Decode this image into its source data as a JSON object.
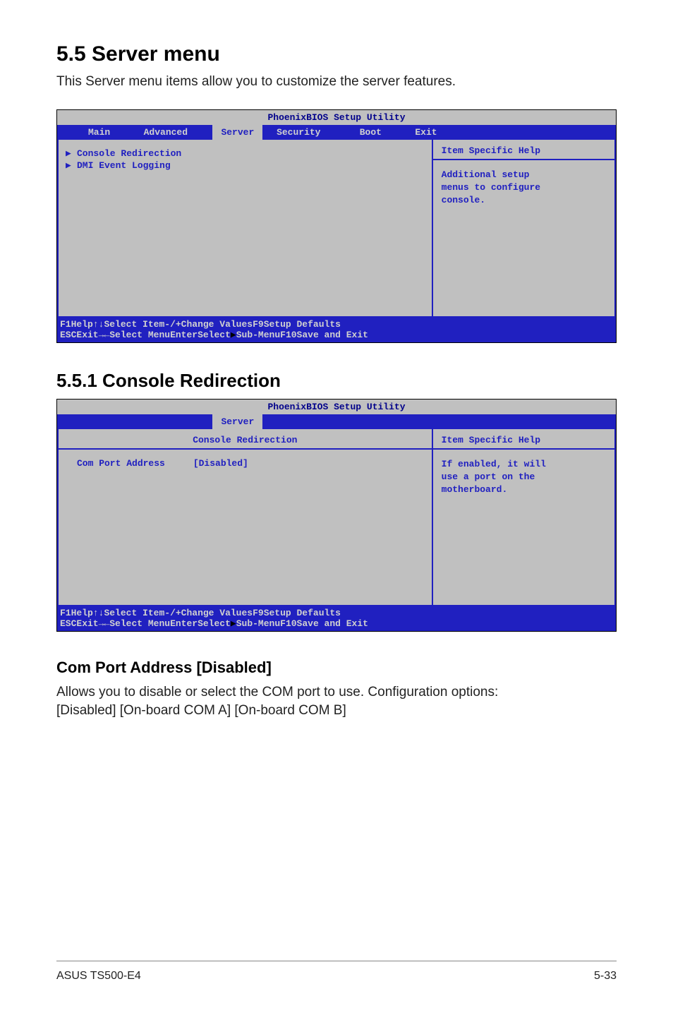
{
  "section_heading": "5.5 Server menu",
  "section_intro": "This Server menu items allow you to customize the server features.",
  "bios1": {
    "title": "PhoenixBIOS Setup Utility",
    "tabs": {
      "main": "Main",
      "advanced": "Advanced",
      "server": "Server",
      "security": "Security",
      "boot": "Boot",
      "exit": "Exit"
    },
    "rows": {
      "r1": "Console Redirection",
      "r2": "DMI Event Logging"
    },
    "help_header": "Item Specific Help",
    "help_text": "Additional setup\nmenus to configure\nconsole."
  },
  "sub_heading": "5.5.1 Console Redirection",
  "bios2": {
    "title": "PhoenixBIOS Setup Utility",
    "tab": "Server",
    "subhead": "Console Redirection",
    "row_label": "Com Port Address",
    "row_value": "[Disabled]",
    "help_header": "Item Specific Help",
    "help_text": "If enabled, it will\nuse a port on the\nmotherboard."
  },
  "option_heading": "Com Port Address [Disabled]",
  "option_text1": "Allows you to disable or select the COM port to use. Configuration options:",
  "option_text2": "[Disabled] [On-board COM A] [On-board COM B]",
  "footer_keys": {
    "l1": {
      "k1": "F1",
      "k1l": "Help",
      "k2": "↑↓",
      "k2l": "Select Item",
      "k3": "-/+",
      "k3l": "Change Values",
      "k4": "F9",
      "k4l": "Setup Defaults"
    },
    "l2": {
      "k1": "ESC",
      "k1l": "Exit",
      "k2": "→←",
      "k2l": "Select Menu",
      "k3": "Enter",
      "k3l_a": "Select",
      "k3l_b": "Sub-Menu",
      "k4": "F10",
      "k4l": "Save and Exit"
    }
  },
  "page_footer": {
    "left": "ASUS TS500-E4",
    "right": "5-33"
  }
}
